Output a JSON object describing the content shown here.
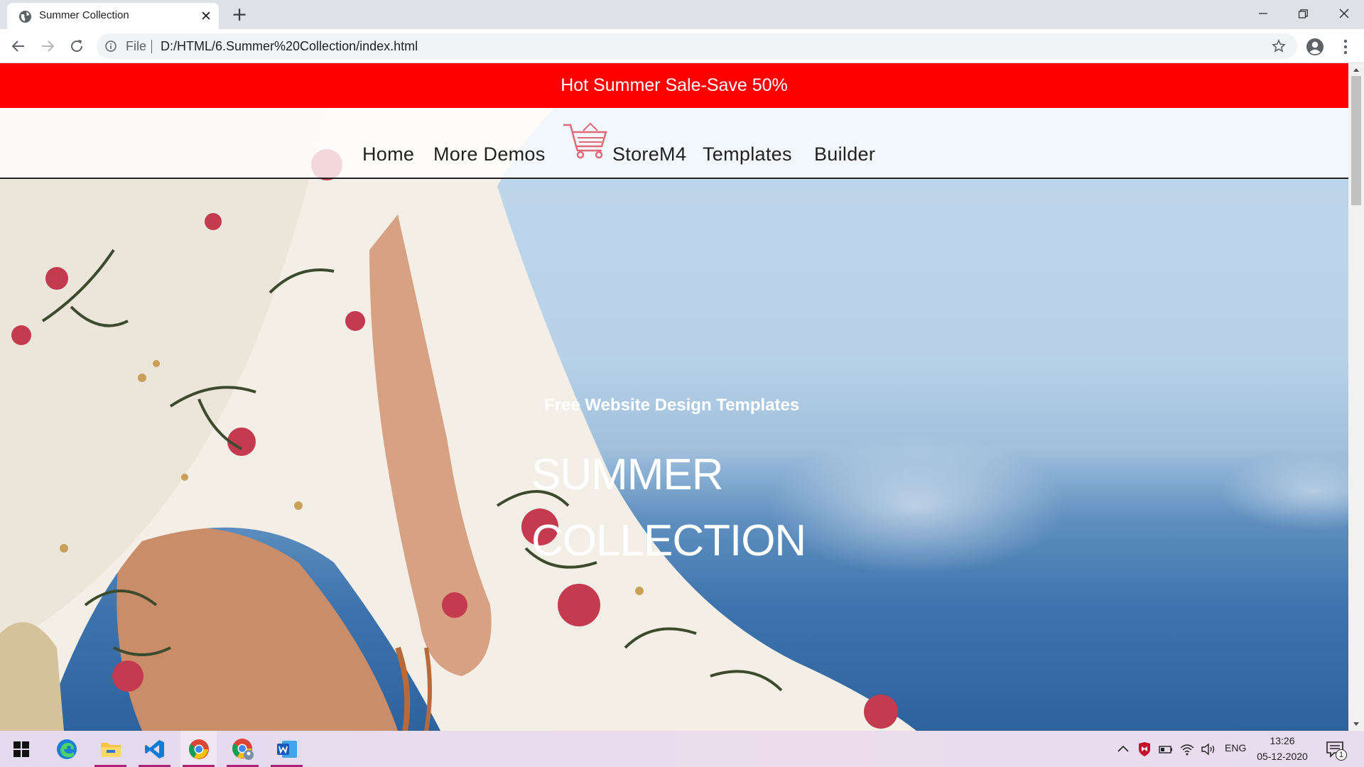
{
  "browser": {
    "tab_title": "Summer Collection",
    "address_scheme_label": "File",
    "address_url": "D:/HTML/6.Summer%20Collection/index.html"
  },
  "page": {
    "sale_banner": "Hot Summer Sale-Save 50%",
    "nav": {
      "home": "Home",
      "more_demos": "More Demos",
      "storem4": "StoreM4",
      "templates": "Templates",
      "builder": "Builder"
    },
    "hero": {
      "subtitle": "Free Website Design Templates",
      "title_line1": "SUMMER",
      "title_line2": "COLLECTION"
    }
  },
  "taskbar": {
    "apps": [
      "start-icon",
      "edge-icon",
      "file-explorer-icon",
      "vscode-icon",
      "chrome-icon",
      "chrome-profile-icon",
      "word-icon"
    ],
    "language": "ENG",
    "time": "13:26",
    "date": "05-12-2020",
    "notification_count": "1"
  },
  "colors": {
    "sale_bar": "#ff0000",
    "taskbar_indicator": "#b0217a",
    "cart_icon": "#e06a7a"
  }
}
